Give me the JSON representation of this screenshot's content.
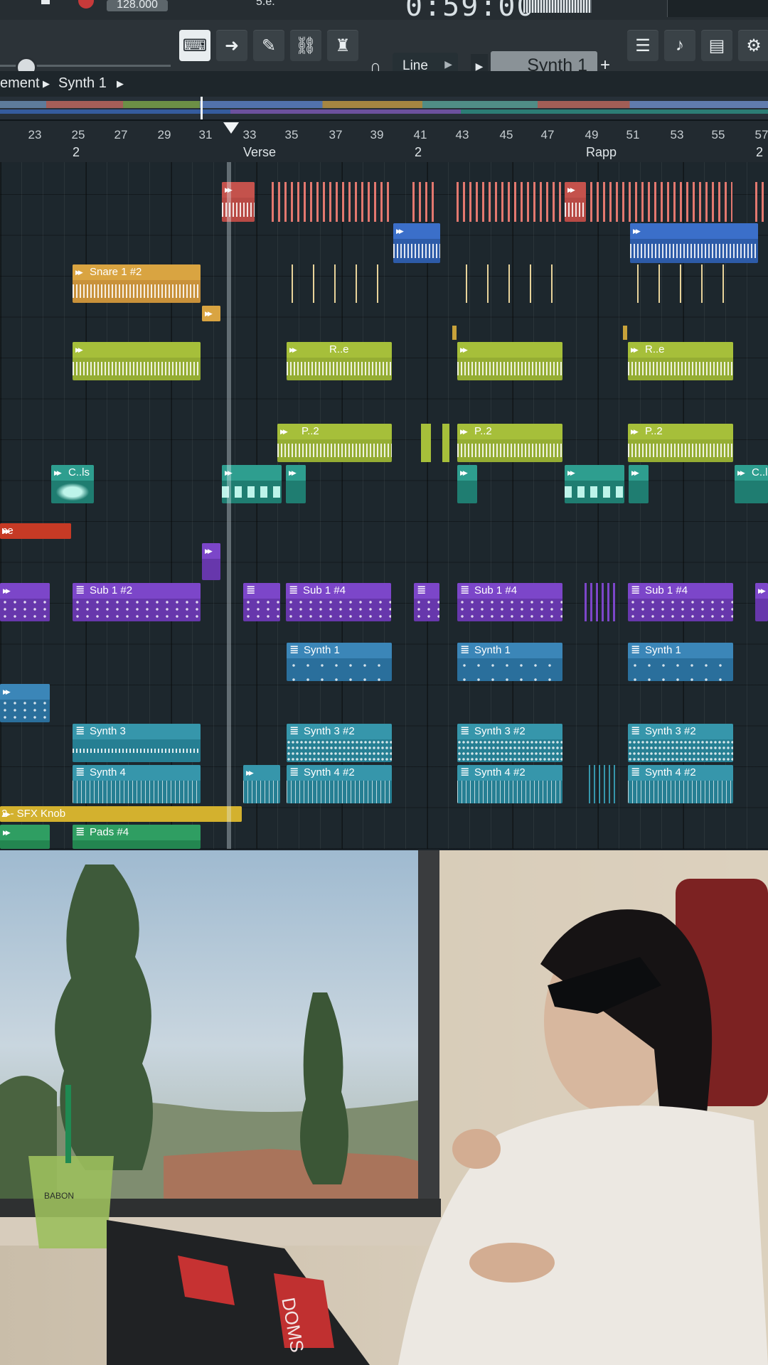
{
  "toolbar": {
    "tempo": "128.000",
    "time": "0:59:00",
    "snap_mode": "Line",
    "channel": "Synth 1",
    "add_label": "+",
    "pattern_label": "5.e."
  },
  "breadcrumb": {
    "part1": "ement",
    "part2": "Synth 1"
  },
  "ruler": {
    "bars": [
      "23",
      "25",
      "27",
      "29",
      "31",
      "33",
      "35",
      "37",
      "39",
      "41",
      "43",
      "45",
      "47",
      "49",
      "51",
      "53",
      "55",
      "57"
    ],
    "markers": [
      "2",
      "Verse",
      "2",
      "Rapp",
      "2"
    ]
  },
  "clips": {
    "snare": "Snare 1 #2",
    "re1": "R..e",
    "re2": "R..e",
    "p2": "P..2",
    "cls": "C..ls",
    "ne": "ne",
    "sub2": "Sub 1 #2",
    "sub4": "Sub 1 #4",
    "synth1": "Synth 1",
    "synth3": "Synth 3",
    "synth3b": "Synth 3 #2",
    "synth4": "Synth 4",
    "synth4b": "Synth 4 #2",
    "sfx": "2 - SFX Knob",
    "pads": "Pads #4"
  },
  "photo": {
    "cup_logo": "BABON",
    "laptop_sticker": "DOMS"
  },
  "colors": {
    "salmon": "#c4524c",
    "blue": "#3b6fc9",
    "gold": "#d9a441",
    "lime": "#a6bf3a",
    "teal": "#2e9e8f",
    "violet": "#7c46c9",
    "sky": "#3b86b8",
    "cyan": "#3696ab",
    "yellow": "#d3b12e",
    "green": "#2f9e62"
  }
}
